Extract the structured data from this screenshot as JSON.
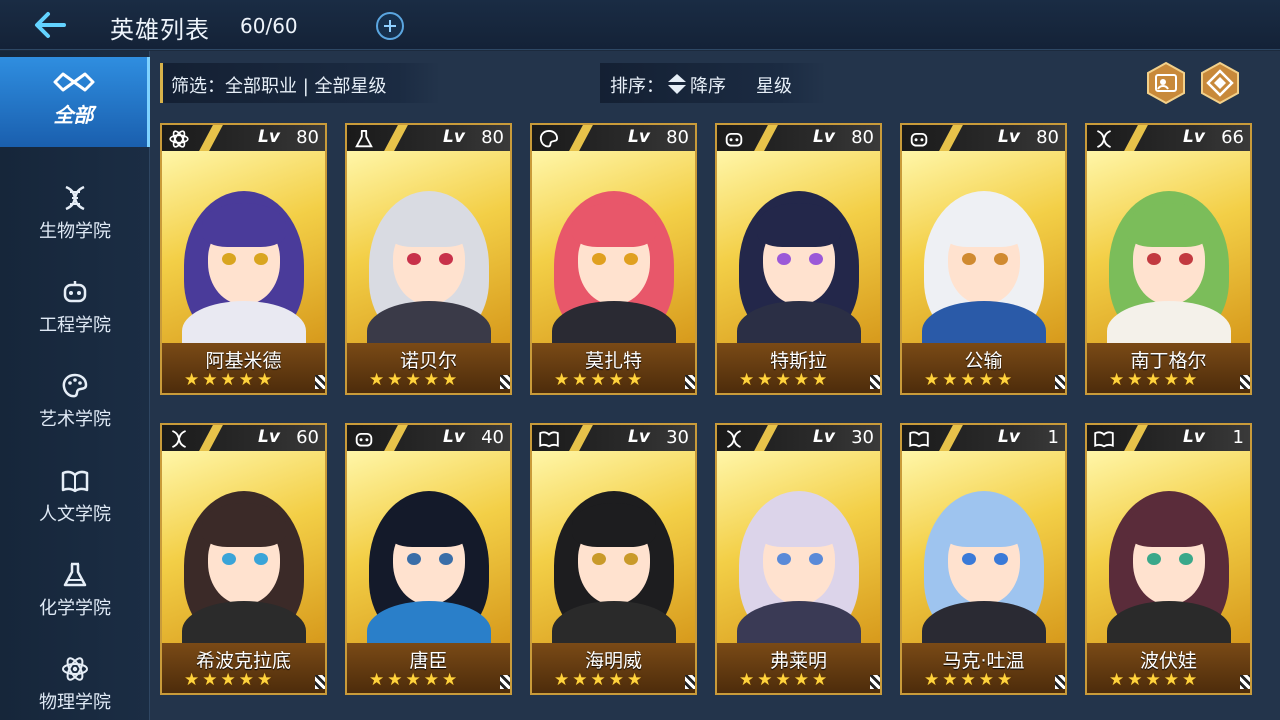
{
  "header": {
    "title": "英雄列表",
    "count": "60/60"
  },
  "sidebar": {
    "items": [
      {
        "label": "全部",
        "icon": "infinity-icon",
        "active": true
      },
      {
        "label": "生物学院",
        "icon": "dna-icon",
        "active": false
      },
      {
        "label": "工程学院",
        "icon": "robot-icon",
        "active": false
      },
      {
        "label": "艺术学院",
        "icon": "palette-icon",
        "active": false
      },
      {
        "label": "人文学院",
        "icon": "book-icon",
        "active": false
      },
      {
        "label": "化学学院",
        "icon": "flask-icon",
        "active": false
      },
      {
        "label": "物理学院",
        "icon": "atom-icon",
        "active": false
      }
    ]
  },
  "filter": {
    "text": "筛选：全部职业 | 全部星级"
  },
  "sort": {
    "label": "排序：",
    "direction": "降序",
    "key": "星级"
  },
  "heroes": [
    {
      "name": "阿基米德",
      "lv_tag": "Lv",
      "level": "80",
      "stars": "★★★★★",
      "class_icon": "atom-icon",
      "hair": "#4a3b9a",
      "eye": "#d9a520",
      "outfit": "#e9e9f2"
    },
    {
      "name": "诺贝尔",
      "lv_tag": "Lv",
      "level": "80",
      "stars": "★★★★★",
      "class_icon": "flask-icon",
      "hair": "#d9dbe2",
      "eye": "#c8314a",
      "outfit": "#3a3a48"
    },
    {
      "name": "莫扎特",
      "lv_tag": "Lv",
      "level": "80",
      "stars": "★★★★★",
      "class_icon": "palette-icon",
      "hair": "#e8576a",
      "eye": "#e0a020",
      "outfit": "#2a2a33"
    },
    {
      "name": "特斯拉",
      "lv_tag": "Lv",
      "level": "80",
      "stars": "★★★★★",
      "class_icon": "robot-icon",
      "hair": "#23274a",
      "eye": "#9b59d8",
      "outfit": "#2b2f45"
    },
    {
      "name": "公输",
      "lv_tag": "Lv",
      "level": "80",
      "stars": "★★★★★",
      "class_icon": "robot-icon",
      "hair": "#eef0f4",
      "eye": "#d08a30",
      "outfit": "#2a5aa8"
    },
    {
      "name": "南丁格尔",
      "lv_tag": "Lv",
      "level": "66",
      "stars": "★★★★★",
      "class_icon": "dna-icon",
      "hair": "#7bbd5a",
      "eye": "#c23a40",
      "outfit": "#f4f1ea"
    },
    {
      "name": "希波克拉底",
      "lv_tag": "Lv",
      "level": "60",
      "stars": "★★★★★",
      "class_icon": "dna-icon",
      "hair": "#3b2a28",
      "eye": "#3aa4d8",
      "outfit": "#2b2b2b"
    },
    {
      "name": "唐臣",
      "lv_tag": "Lv",
      "level": "40",
      "stars": "★★★★★",
      "class_icon": "robot-icon",
      "hair": "#141a2a",
      "eye": "#3a6ea8",
      "outfit": "#2a7fc9"
    },
    {
      "name": "海明威",
      "lv_tag": "Lv",
      "level": "30",
      "stars": "★★★★★",
      "class_icon": "book-icon",
      "hair": "#1d1d1f",
      "eye": "#c99a2a",
      "outfit": "#2a2a2a"
    },
    {
      "name": "弗莱明",
      "lv_tag": "Lv",
      "level": "30",
      "stars": "★★★★★",
      "class_icon": "dna-icon",
      "hair": "#dcd4ea",
      "eye": "#5a8ad8",
      "outfit": "#3a3a55"
    },
    {
      "name": "马克·吐温",
      "lv_tag": "Lv",
      "level": "1",
      "stars": "★★★★★",
      "class_icon": "book-icon",
      "hair": "#9ec4ef",
      "eye": "#3a7ad8",
      "outfit": "#2a2a33"
    },
    {
      "name": "波伏娃",
      "lv_tag": "Lv",
      "level": "1",
      "stars": "★★★★★",
      "class_icon": "book-icon",
      "hair": "#5a2c3a",
      "eye": "#3aa88a",
      "outfit": "#2a2a2a"
    }
  ],
  "colors": {
    "accent": "#2f8ee0",
    "card_border": "#c99b3a",
    "star": "#ffd33d"
  }
}
